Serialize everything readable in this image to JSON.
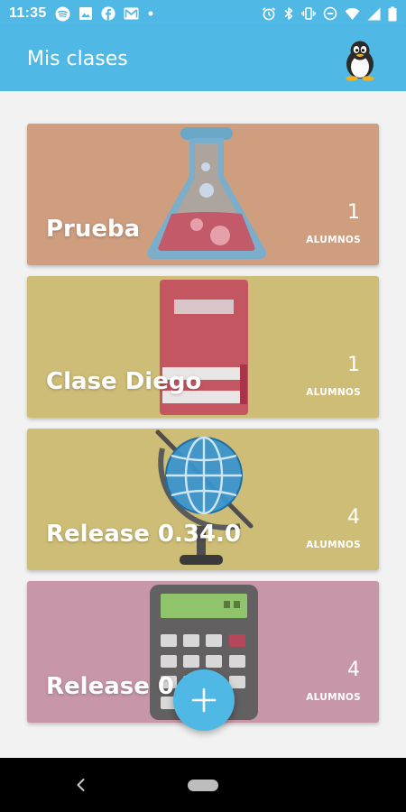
{
  "status_bar": {
    "time": "11:35",
    "notification_icons": [
      "spotify-icon",
      "image-icon",
      "facebook-icon",
      "gmail-icon",
      "dot-icon"
    ],
    "system_icons": [
      "alarm-icon",
      "bluetooth-icon",
      "vibrate-icon",
      "dnd-icon",
      "wifi-icon",
      "signal-icon",
      "battery-icon"
    ]
  },
  "app_bar": {
    "title": "Mis clases",
    "avatar_icon": "penguin-avatar-icon"
  },
  "classes": [
    {
      "name": "Prueba",
      "count": "1",
      "count_label": "ALUMNOS",
      "color": "#cf9e7f",
      "illustration": "flask-icon"
    },
    {
      "name": "Clase Diego",
      "count": "1",
      "count_label": "ALUMNOS",
      "color": "#cdbd76",
      "illustration": "book-icon"
    },
    {
      "name": "Release 0.34.0",
      "count": "4",
      "count_label": "ALUMNOS",
      "color": "#cdbd76",
      "illustration": "globe-icon"
    },
    {
      "name": "Release 0.",
      "count": "4",
      "count_label": "ALUMNOS",
      "color": "#c796a9",
      "illustration": "calculator-icon"
    }
  ],
  "fab": {
    "icon": "plus-icon",
    "color": "#4fb8e5"
  },
  "nav_bar": {
    "back_icon": "back-arrow-icon",
    "home_icon": "home-pill-icon"
  }
}
